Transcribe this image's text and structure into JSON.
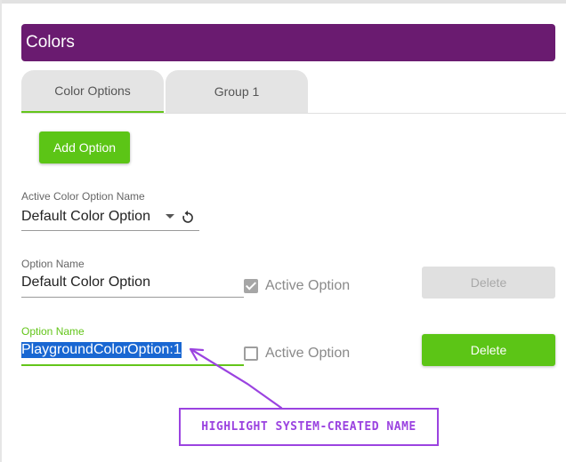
{
  "header": {
    "title": "Colors"
  },
  "tabs": [
    {
      "label": "Color Options",
      "active": true
    },
    {
      "label": "Group 1",
      "active": false
    }
  ],
  "toolbar": {
    "add_option_label": "Add Option"
  },
  "active_color_option": {
    "label": "Active Color Option Name",
    "value": "Default Color Option",
    "icons": [
      "chevron-down-icon",
      "reset-icon"
    ]
  },
  "options": [
    {
      "name_label": "Option Name",
      "name_value": "Default Color Option",
      "active_label": "Active Option",
      "active_checked": true,
      "active_disabled": true,
      "delete_label": "Delete",
      "delete_enabled": false
    },
    {
      "name_label": "Option Name",
      "name_value": "PlaygroundColorOption:1",
      "name_selected": true,
      "active_label": "Active Option",
      "active_checked": false,
      "delete_label": "Delete",
      "delete_enabled": true
    }
  ],
  "annotation": {
    "text": "HIGHLIGHT SYSTEM-CREATED NAME"
  },
  "colors": {
    "header_bg": "#6a1b70",
    "accent_green": "#5cc516",
    "annotation_purple": "#9b43e0",
    "selection_blue": "#1967d2"
  }
}
